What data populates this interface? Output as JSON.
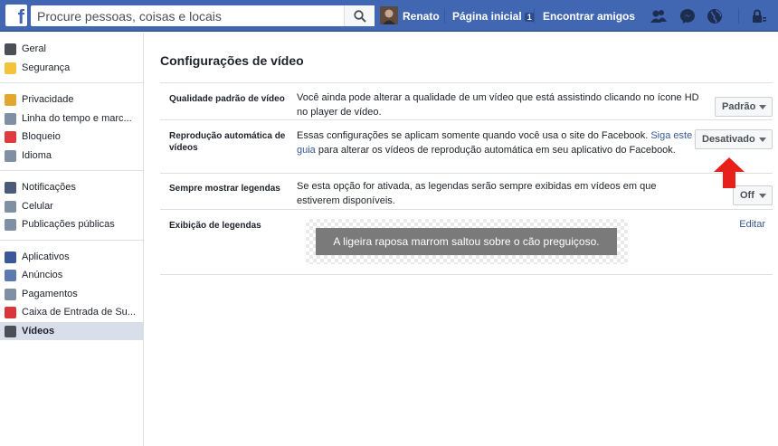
{
  "topbar": {
    "search_placeholder": "Procure pessoas, coisas e locais",
    "user_name": "Renato",
    "home_label": "Página inicial",
    "home_badge": "1",
    "find_friends_label": "Encontrar amigos"
  },
  "sidebar": {
    "groups": [
      [
        {
          "label": "Geral",
          "icon": "gear-icon",
          "color": "#4b4f56"
        },
        {
          "label": "Segurança",
          "icon": "shield-icon",
          "color": "#f5c33b"
        }
      ],
      [
        {
          "label": "Privacidade",
          "icon": "lock-icon",
          "color": "#e2a631"
        },
        {
          "label": "Linha do tempo e marc...",
          "icon": "timeline-icon",
          "color": "#7f8fa4"
        },
        {
          "label": "Bloqueio",
          "icon": "block-icon",
          "color": "#e0393e"
        },
        {
          "label": "Idioma",
          "icon": "language-icon",
          "color": "#7f8fa4"
        }
      ],
      [
        {
          "label": "Notificações",
          "icon": "globe-icon",
          "color": "#4b5a7a"
        },
        {
          "label": "Celular",
          "icon": "mobile-icon",
          "color": "#7f8fa4"
        },
        {
          "label": "Publicações públicas",
          "icon": "rss-icon",
          "color": "#7f8fa4"
        }
      ],
      [
        {
          "label": "Aplicativos",
          "icon": "apps-icon",
          "color": "#3b5998"
        },
        {
          "label": "Anúncios",
          "icon": "ads-icon",
          "color": "#5b7ab0"
        },
        {
          "label": "Pagamentos",
          "icon": "payments-icon",
          "color": "#7f8fa4"
        },
        {
          "label": "Caixa de Entrada de Su...",
          "icon": "support-icon",
          "color": "#d8363b"
        },
        {
          "label": "Vídeos",
          "icon": "film-icon",
          "color": "#4b4f56",
          "active": true
        }
      ]
    ]
  },
  "main": {
    "title": "Configurações de vídeo",
    "rows": {
      "quality": {
        "label": "Qualidade padrão de vídeo",
        "desc": "Você ainda pode alterar a qualidade de um vídeo que está assistindo clicando no ícone HD no player de vídeo.",
        "value": "Padrão"
      },
      "autoplay": {
        "label": "Reprodução automática de vídeos",
        "desc_before": "Essas configurações se aplicam somente quando você usa o site do Facebook. ",
        "desc_link": "Siga este guia",
        "desc_after": " para alterar os vídeos de reprodução automática em seu aplicativo do Facebook.",
        "value": "Desativado"
      },
      "captions": {
        "label": "Sempre mostrar legendas",
        "desc": "Se esta opção for ativada, as legendas serão sempre exibidas em vídeos em que estiverem disponíveis.",
        "value": "Off"
      },
      "caption_display": {
        "label": "Exibição de legendas",
        "preview_text": "A ligeira raposa marrom saltou sobre o cão preguiçoso.",
        "edit_label": "Editar"
      }
    }
  },
  "annotation": {
    "arrow_color": "#e8201a"
  }
}
